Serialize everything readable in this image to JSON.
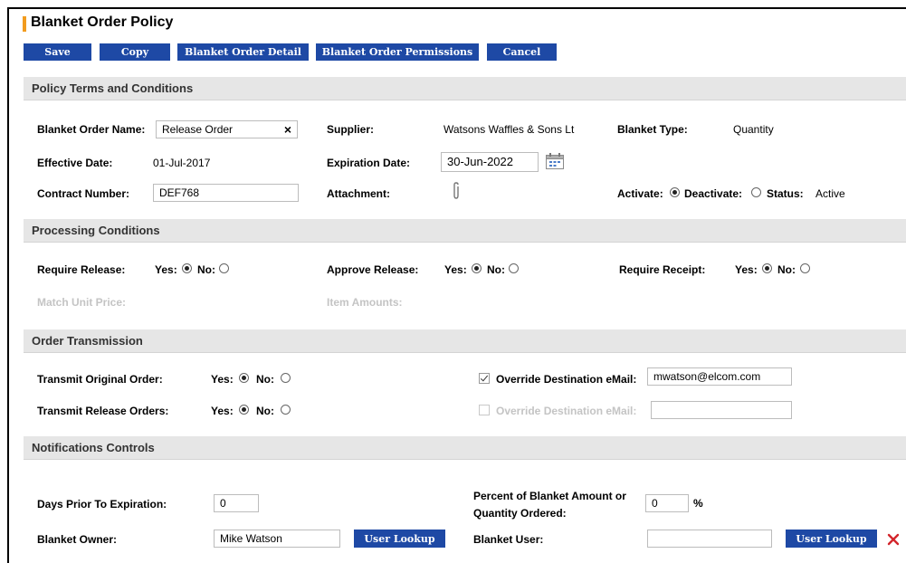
{
  "page": {
    "title": "Blanket Order Policy"
  },
  "toolbar": {
    "save": "Save",
    "copy": "Copy",
    "detail": "Blanket Order Detail",
    "permissions": "Blanket Order Permissions",
    "cancel": "Cancel"
  },
  "terms": {
    "heading": "Policy Terms and Conditions",
    "name_label": "Blanket Order Name:",
    "name_value": "Release Order",
    "clear_glyph": "×",
    "supplier_label": "Supplier:",
    "supplier_value": "Watsons Waffles & Sons Lt",
    "type_label": "Blanket Type:",
    "type_value": "Quantity",
    "effective_label": "Effective Date:",
    "effective_value": "01-Jul-2017",
    "expiration_label": "Expiration Date:",
    "expiration_value": "30-Jun-2022",
    "contract_label": "Contract Number:",
    "contract_value": "DEF768",
    "attachment_label": "Attachment:",
    "activate_label": "Activate:",
    "activate_selected": true,
    "deactivate_label": "Deactivate:",
    "status_label": "Status:",
    "status_value": "Active"
  },
  "processing": {
    "heading": "Processing Conditions",
    "require_release_label": "Require Release:",
    "approve_release_label": "Approve Release:",
    "require_receipt_label": "Require Receipt:",
    "yes": "Yes:",
    "no": "No:",
    "match_unit_price_label": "Match Unit Price:",
    "item_amounts_label": "Item Amounts:"
  },
  "transmission": {
    "heading": "Order Transmission",
    "original_label": "Transmit Original Order:",
    "release_label": "Transmit Release Orders:",
    "yes": "Yes:",
    "no": "No:",
    "override_label": "Override Destination eMail:",
    "override_checked": true,
    "override_email": "mwatson@elcom.com",
    "override2_label": "Override Destination eMail:",
    "override2_checked": false,
    "override2_email": ""
  },
  "notifications": {
    "heading": "Notifications Controls",
    "days_label": "Days Prior To Expiration:",
    "days_value": "0",
    "percent_label_1": "Percent of Blanket Amount or",
    "percent_label_2": "Quantity Ordered:",
    "percent_value": "0",
    "percent_sign": "%",
    "owner_label": "Blanket Owner:",
    "owner_value": "Mike Watson",
    "lookup1": "User Lookup",
    "user_label": "Blanket User:",
    "user_value": "",
    "lookup2": "User Lookup"
  },
  "colors": {
    "accent": "#f29c1f",
    "button": "#1e49a5",
    "delete": "#d3252b"
  }
}
